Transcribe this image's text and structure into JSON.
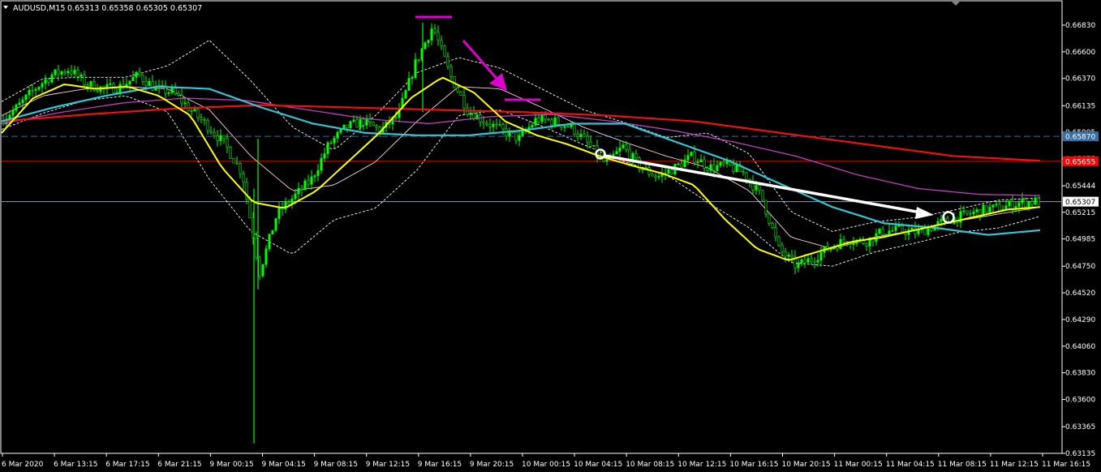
{
  "header": {
    "symbol_label": "AUDUSD,M15",
    "ohlc": "0.65313 0.65358 0.65305 0.65307",
    "menu_icon": "triangle-down-icon"
  },
  "colors": {
    "background": "#000000",
    "candles": "#00ff00",
    "axis": "#ffffff",
    "ma_fast": "#ffff00",
    "ma_mid": "#33c5d6",
    "ma_slow": "#ee1111",
    "ma_magenta": "#c040c0",
    "envelope": "#ffd0e0",
    "bollinger": "#ffffff",
    "annotation_magenta": "#e000d0",
    "annotation_white": "#ffffff",
    "level_dashed": "#3a6da0",
    "level_red": "#ff0000",
    "level_current": "#8aa0c0"
  },
  "chart_data": {
    "type": "candlestick",
    "symbol": "AUDUSD",
    "timeframe": "M15",
    "last": {
      "open": 0.65313,
      "high": 0.65358,
      "low": 0.65305,
      "close": 0.65307
    },
    "ylim": [
      0.6312,
      0.6691
    ],
    "y_ticks": [
      "0.66830",
      "0.66600",
      "0.66370",
      "0.66135",
      "0.65905",
      "0.65675",
      "0.65444",
      "0.65215",
      "0.64985",
      "0.64750",
      "0.64520",
      "0.64290",
      "0.64060",
      "0.63830",
      "0.63600",
      "0.63365",
      "0.63135"
    ],
    "y_tick_values": [
      0.6683,
      0.666,
      0.6637,
      0.66135,
      0.65905,
      0.65675,
      0.65444,
      0.65215,
      0.64985,
      0.6475,
      0.6452,
      0.6429,
      0.6406,
      0.6383,
      0.636,
      0.63365,
      0.63135
    ],
    "x_ticks": [
      "6 Mar 2020",
      "6 Mar 13:15",
      "6 Mar 17:15",
      "6 Mar 21:15",
      "9 Mar 00:15",
      "9 Mar 04:15",
      "9 Mar 08:15",
      "9 Mar 12:15",
      "9 Mar 16:15",
      "9 Mar 20:15",
      "10 Mar 00:15",
      "10 Mar 04:15",
      "10 Mar 08:15",
      "10 Mar 12:15",
      "10 Mar 16:15",
      "10 Mar 20:15",
      "11 Mar 00:15",
      "11 Mar 04:15",
      "11 Mar 08:15",
      "11 Mar 12:15",
      "11 Mar 16:15"
    ],
    "price_labels": [
      {
        "text": "0.65870",
        "value": 0.6587,
        "style": "dashed"
      },
      {
        "text": "0.65655",
        "value": 0.65655,
        "style": "red"
      },
      {
        "text": "0.65307",
        "value": 0.65307,
        "style": "current"
      }
    ],
    "key_points": [
      0.66,
      0.6612,
      0.6628,
      0.664,
      0.6645,
      0.6632,
      0.6628,
      0.663,
      0.664,
      0.6628,
      0.6625,
      0.661,
      0.6596,
      0.658,
      0.6555,
      0.647,
      0.652,
      0.6535,
      0.655,
      0.658,
      0.6595,
      0.66,
      0.6592,
      0.6605,
      0.665,
      0.6682,
      0.664,
      0.661,
      0.66,
      0.6592,
      0.6585,
      0.6602,
      0.66,
      0.6595,
      0.658,
      0.6563,
      0.6578,
      0.656,
      0.6552,
      0.656,
      0.657,
      0.656,
      0.6562,
      0.6555,
      0.6535,
      0.649,
      0.6475,
      0.6482,
      0.6492,
      0.6498,
      0.6496,
      0.6505,
      0.6506,
      0.6504,
      0.651,
      0.6516,
      0.652,
      0.6524,
      0.6526,
      0.653,
      0.6531
    ],
    "ma_fast": [
      0.659,
      0.662,
      0.6632,
      0.6628,
      0.663,
      0.6622,
      0.6605,
      0.656,
      0.653,
      0.6525,
      0.654,
      0.6565,
      0.659,
      0.662,
      0.6638,
      0.6625,
      0.66,
      0.6588,
      0.658,
      0.657,
      0.6562,
      0.6555,
      0.6545,
      0.6515,
      0.649,
      0.648,
      0.6488,
      0.6496,
      0.65,
      0.6506,
      0.6512,
      0.6518,
      0.6524,
      0.6526
    ],
    "ma_mid": [
      0.66,
      0.6612,
      0.6622,
      0.663,
      0.6628,
      0.6612,
      0.6598,
      0.659,
      0.6588,
      0.6588,
      0.6592,
      0.6598,
      0.6598,
      0.6582,
      0.6566,
      0.6546,
      0.6526,
      0.6512,
      0.6508,
      0.6502,
      0.6506
    ],
    "ma_slow": [
      0.66,
      0.6606,
      0.6611,
      0.6614,
      0.6612,
      0.661,
      0.6608,
      0.6605,
      0.66,
      0.659,
      0.658,
      0.657,
      0.6566
    ],
    "ma_magenta": [
      0.6598,
      0.6608,
      0.6616,
      0.662,
      0.6618,
      0.661,
      0.6602,
      0.6598,
      0.6604,
      0.6606,
      0.66,
      0.6592,
      0.6582,
      0.657,
      0.6554,
      0.6542,
      0.6537,
      0.6536
    ],
    "bb_mid": [
      0.6605,
      0.6622,
      0.6628,
      0.663,
      0.6628,
      0.661,
      0.657,
      0.654,
      0.6545,
      0.6565,
      0.66,
      0.663,
      0.6628,
      0.6612,
      0.6595,
      0.6582,
      0.657,
      0.656,
      0.654,
      0.65,
      0.649,
      0.65,
      0.6506,
      0.6514,
      0.652,
      0.6526
    ],
    "bb_width": [
      0.0012,
      0.0015,
      0.001,
      0.0008,
      0.002,
      0.006,
      0.0065,
      0.0055,
      0.003,
      0.004,
      0.0042,
      0.0025,
      0.0018,
      0.0016,
      0.0015,
      0.0017,
      0.0016,
      0.003,
      0.0032,
      0.0022,
      0.0015,
      0.0013,
      0.0011,
      0.001,
      0.0012,
      0.0008
    ]
  }
}
